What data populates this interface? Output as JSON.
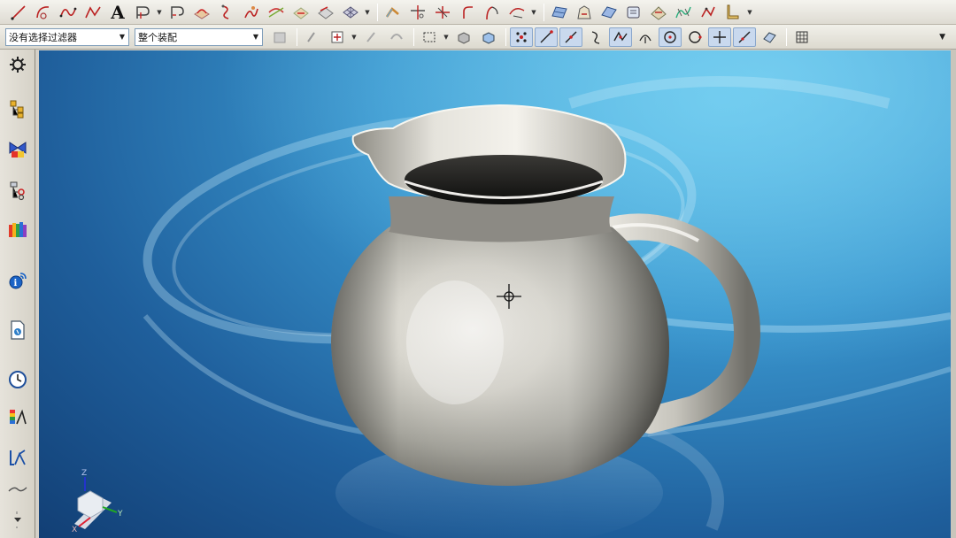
{
  "toolbar_top": {
    "buttons": [
      {
        "name": "line-icon"
      },
      {
        "name": "arc-icon"
      },
      {
        "name": "spline-icon"
      },
      {
        "name": "polyline-icon"
      },
      {
        "name": "text-icon",
        "glyph": "A"
      },
      {
        "name": "offset-curve-icon"
      },
      {
        "name": "bridge-curve-icon"
      },
      {
        "name": "project-curve-icon"
      },
      {
        "name": "curve-on-surface-icon"
      },
      {
        "name": "helix-icon"
      },
      {
        "name": "intersection-curve-icon"
      },
      {
        "name": "section-curve-icon"
      },
      {
        "name": "extract-curve-icon"
      },
      {
        "name": "isoparametric-curve-icon"
      },
      {
        "name": "curve-edit-icon"
      },
      {
        "name": "trim-curve-icon"
      },
      {
        "name": "split-curve-icon"
      },
      {
        "name": "fillet-curve-icon"
      },
      {
        "name": "curve-length-icon"
      },
      {
        "name": "through-curves-icon"
      },
      {
        "name": "swept-surface-icon"
      },
      {
        "name": "n-sided-surface-icon"
      },
      {
        "name": "face-blend-icon"
      },
      {
        "name": "offset-surface-icon"
      },
      {
        "name": "trimmed-sheet-icon"
      },
      {
        "name": "analysis-curvature-icon"
      },
      {
        "name": "deviation-check-icon"
      }
    ]
  },
  "toolbar_selection": {
    "type_filter": {
      "value": "没有选择过滤器"
    },
    "scope": {
      "value": "整个装配"
    }
  },
  "resource_bar": {
    "items": [
      {
        "name": "settings-gear-icon"
      },
      {
        "name": "assembly-navigator-icon"
      },
      {
        "name": "constraint-navigator-icon"
      },
      {
        "name": "part-navigator-icon"
      },
      {
        "name": "reuse-library-icon"
      },
      {
        "name": "web-browser-icon"
      },
      {
        "name": "history-icon"
      },
      {
        "name": "process-studio-icon"
      },
      {
        "name": "roles-icon"
      },
      {
        "name": "system-materials-icon"
      }
    ]
  },
  "viewport": {
    "model": "pitcher-jug",
    "background_top": "#5ec2ea",
    "background_bottom": "#123f75",
    "triad_axes": [
      "X",
      "Y",
      "Z"
    ]
  }
}
